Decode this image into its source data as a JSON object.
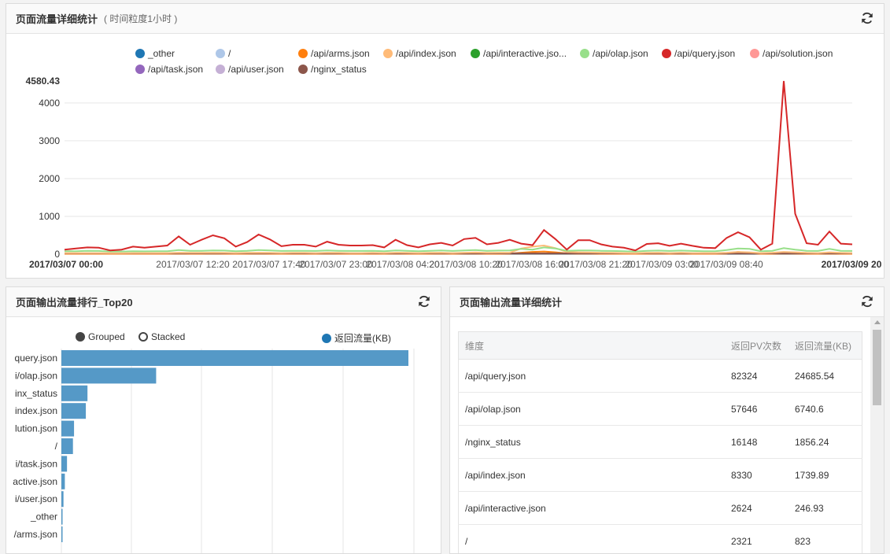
{
  "colors": {
    "_other": "#1f77b4",
    "/": "#aec7e8",
    "/api/arms.json": "#ff7f0e",
    "/api/index.json": "#ffbb78",
    "/api/interactive.json": "#2ca02c",
    "/api/olap.json": "#98df8a",
    "/api/query.json": "#d62728",
    "/api/solution.json": "#ff9896",
    "/api/task.json": "#9467bd",
    "/api/user.json": "#c5b0d5",
    "/nginx_status": "#8c564b",
    "bar": "#5599c7"
  },
  "top_panel": {
    "title": "页面流量详细统计",
    "subtitle": "( 时间粒度1小时 )",
    "refresh_icon": "refresh-icon",
    "legend": [
      "_other",
      "/",
      "/api/arms.json",
      "/api/index.json",
      "/api/interactive.jso...",
      "/api/olap.json",
      "/api/query.json",
      "/api/solution.json",
      "/api/task.json",
      "/api/user.json",
      "/nginx_status"
    ],
    "y_max_label": "4580.43"
  },
  "left_panel": {
    "title": "页面输出流量排行_Top20",
    "refresh_icon": "refresh-icon",
    "controls": {
      "grouped": "Grouped",
      "stacked": "Stacked",
      "series": "返回流量(KB)"
    }
  },
  "right_panel": {
    "title": "页面输出流量详细统计",
    "refresh_icon": "refresh-icon",
    "columns": [
      "维度",
      "返回PV次数",
      "返回流量(KB)"
    ],
    "rows": [
      [
        "/api/query.json",
        "82324",
        "24685.54"
      ],
      [
        "/api/olap.json",
        "57646",
        "6740.6"
      ],
      [
        "/nginx_status",
        "16148",
        "1856.24"
      ],
      [
        "/api/index.json",
        "8330",
        "1739.89"
      ],
      [
        "/api/interactive.json",
        "2624",
        "246.93"
      ],
      [
        "/",
        "2321",
        "823"
      ]
    ]
  },
  "chart_data": [
    {
      "type": "line",
      "title": "",
      "x_tick_labels": [
        "2017/03/07 00:00",
        "2017/03/07 12:20",
        "2017/03/07 17:40",
        "2017/03/07 23:00",
        "2017/03/08 04:20",
        "2017/03/08 10:20",
        "2017/03/08 16:00",
        "2017/03/08 21:20",
        "2017/03/09 03:00",
        "2017/03/09 08:40",
        "2017/03/09 20"
      ],
      "y_ticks": [
        0,
        1000,
        2000,
        3000,
        4000
      ],
      "ylim": [
        0,
        4580.43
      ],
      "grid": true,
      "legend_position": "top",
      "series": [
        {
          "name": "/api/query.json",
          "values": [
            120,
            150,
            180,
            170,
            100,
            120,
            200,
            170,
            200,
            230,
            470,
            250,
            380,
            500,
            420,
            200,
            320,
            520,
            390,
            210,
            250,
            250,
            200,
            330,
            250,
            230,
            230,
            240,
            180,
            380,
            240,
            180,
            260,
            300,
            230,
            400,
            430,
            260,
            300,
            380,
            280,
            240,
            640,
            400,
            120,
            370,
            370,
            260,
            200,
            170,
            100,
            270,
            290,
            220,
            280,
            220,
            170,
            160,
            430,
            580,
            450,
            120,
            280,
            4580,
            1070,
            290,
            250,
            600,
            280,
            260
          ]
        },
        {
          "name": "/api/olap.json",
          "values": [
            80,
            80,
            90,
            85,
            70,
            70,
            80,
            75,
            80,
            80,
            110,
            90,
            90,
            100,
            95,
            80,
            90,
            110,
            100,
            85,
            90,
            90,
            85,
            100,
            90,
            85,
            85,
            90,
            80,
            100,
            90,
            80,
            90,
            100,
            85,
            100,
            110,
            90,
            95,
            100,
            140,
            120,
            180,
            150,
            90,
            100,
            100,
            90,
            85,
            80,
            70,
            90,
            95,
            85,
            95,
            85,
            80,
            80,
            110,
            150,
            140,
            80,
            90,
            160,
            120,
            90,
            85,
            140,
            90,
            85
          ]
        },
        {
          "name": "/api/index.json",
          "values": [
            30,
            30,
            30,
            30,
            25,
            25,
            30,
            30,
            30,
            30,
            40,
            35,
            35,
            40,
            35,
            30,
            35,
            40,
            35,
            30,
            35,
            35,
            30,
            40,
            35,
            30,
            30,
            35,
            30,
            40,
            35,
            30,
            35,
            40,
            30,
            40,
            45,
            35,
            40,
            40,
            150,
            200,
            230,
            160,
            60,
            50,
            45,
            40,
            35,
            30,
            25,
            35,
            40,
            30,
            40,
            30,
            30,
            30,
            40,
            60,
            50,
            30,
            40,
            60,
            50,
            35,
            30,
            50,
            35,
            30
          ]
        },
        {
          "name": "/nginx_status",
          "values": [
            20,
            20,
            20,
            20,
            20,
            20,
            20,
            20,
            20,
            20,
            20,
            20,
            20,
            20,
            20,
            20,
            20,
            20,
            20,
            20,
            20,
            20,
            20,
            20,
            20,
            20,
            20,
            20,
            20,
            20,
            20,
            20,
            20,
            20,
            20,
            20,
            20,
            20,
            20,
            20,
            20,
            20,
            20,
            20,
            20,
            20,
            20,
            20,
            20,
            20,
            20,
            20,
            20,
            20,
            20,
            20,
            20,
            20,
            20,
            20,
            20,
            20,
            20,
            20,
            20,
            20,
            20,
            20,
            20,
            20
          ]
        },
        {
          "name": "/api/arms.json",
          "values": [
            10,
            10,
            10,
            10,
            10,
            10,
            10,
            10,
            10,
            10,
            15,
            10,
            10,
            15,
            10,
            10,
            10,
            15,
            10,
            10,
            10,
            10,
            10,
            15,
            10,
            10,
            10,
            10,
            10,
            15,
            10,
            10,
            10,
            15,
            10,
            15,
            15,
            10,
            10,
            15,
            40,
            60,
            70,
            50,
            20,
            15,
            15,
            10,
            10,
            10,
            10,
            10,
            15,
            10,
            15,
            10,
            10,
            10,
            15,
            60,
            30,
            10,
            10,
            20,
            15,
            10,
            10,
            15,
            10,
            10
          ]
        }
      ]
    },
    {
      "type": "bar",
      "orientation": "horizontal",
      "categories": [
        "query.json",
        "i/olap.json",
        "inx_status",
        "index.json",
        "lution.json",
        "/",
        "i/task.json",
        "active.json",
        "i/user.json",
        "_other",
        "/arms.json"
      ],
      "series": [
        {
          "name": "返回流量(KB)",
          "values": [
            24685.54,
            6740.6,
            1856.24,
            1739.89,
            900,
            823,
            400,
            246.93,
            150,
            80,
            40
          ]
        }
      ],
      "xlim": [
        0,
        25000
      ],
      "grid": true,
      "legend_position": "top-right"
    }
  ]
}
